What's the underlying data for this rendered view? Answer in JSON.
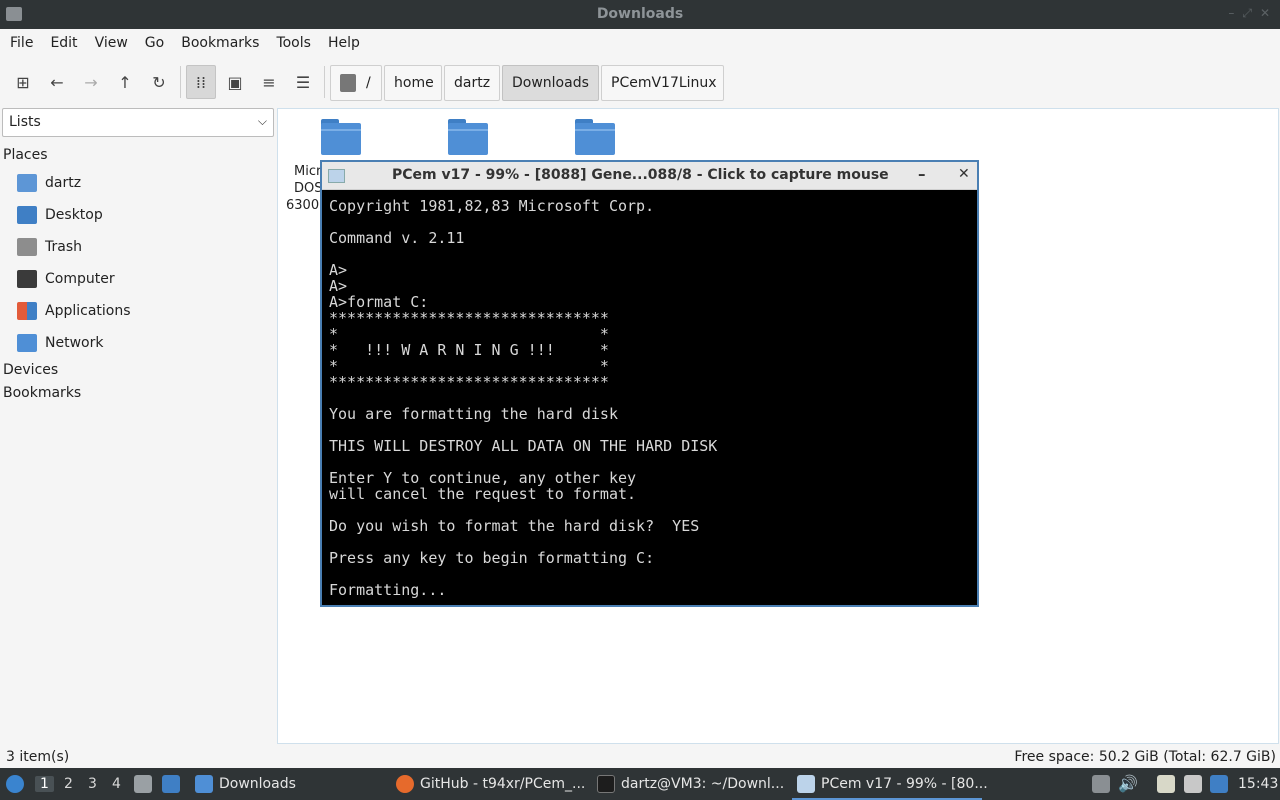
{
  "window": {
    "title": "Downloads"
  },
  "menu": [
    "File",
    "Edit",
    "View",
    "Go",
    "Bookmarks",
    "Tools",
    "Help"
  ],
  "toolbar": {
    "icons": [
      "new-tab-icon",
      "back-icon",
      "forward-icon",
      "up-icon",
      "reload-icon",
      "icon-view-icon",
      "thumbnail-view-icon",
      "compact-view-icon",
      "detailed-list-icon"
    ],
    "breadcrumbs": [
      {
        "label": "/"
      },
      {
        "label": "home"
      },
      {
        "label": "dartz"
      },
      {
        "label": "Downloads"
      },
      {
        "label": "PCemV17Linux"
      }
    ]
  },
  "sidebar": {
    "mode": "Lists",
    "places_title": "Places",
    "places": [
      "dartz",
      "Desktop",
      "Trash",
      "Computer",
      "Applications",
      "Network"
    ],
    "devices_title": "Devices",
    "bookmarks_title": "Bookmarks"
  },
  "files": {
    "visible_label_fragments": [
      "Micr",
      "DOS",
      "6300"
    ]
  },
  "status": {
    "items": "3 item(s)",
    "free_space": "Free space: 50.2 GiB (Total: 62.7 GiB)"
  },
  "pcem": {
    "title": "PCem v17 - 99% - [8088] Gene...088/8 - Click to capture mouse",
    "minimize": "–",
    "close": "✕",
    "screen_lines": [
      "Copyright 1981,82,83 Microsoft Corp.",
      "",
      "Command v. 2.11",
      "",
      "A>",
      "A>",
      "A>format C:",
      "*******************************",
      "*                             *",
      "*   !!! W A R N I N G !!!     *",
      "*                             *",
      "*******************************",
      "",
      "You are formatting the hard disk",
      "",
      "THIS WILL DESTROY ALL DATA ON THE HARD DISK",
      "",
      "Enter Y to continue, any other key",
      "will cancel the request to format.",
      "",
      "Do you wish to format the hard disk?  YES",
      "",
      "Press any key to begin formatting C:",
      "",
      "Formatting..."
    ]
  },
  "taskbar": {
    "workspaces": [
      "1",
      "2",
      "3",
      "4"
    ],
    "active_workspace": "1",
    "tasks": [
      {
        "label": "Downloads"
      },
      {
        "label": "GitHub - t94xr/PCem_..."
      },
      {
        "label": "dartz@VM3: ~/Downl..."
      },
      {
        "label": "PCem v17 - 99% - [80..."
      }
    ],
    "clock": "15:43"
  }
}
